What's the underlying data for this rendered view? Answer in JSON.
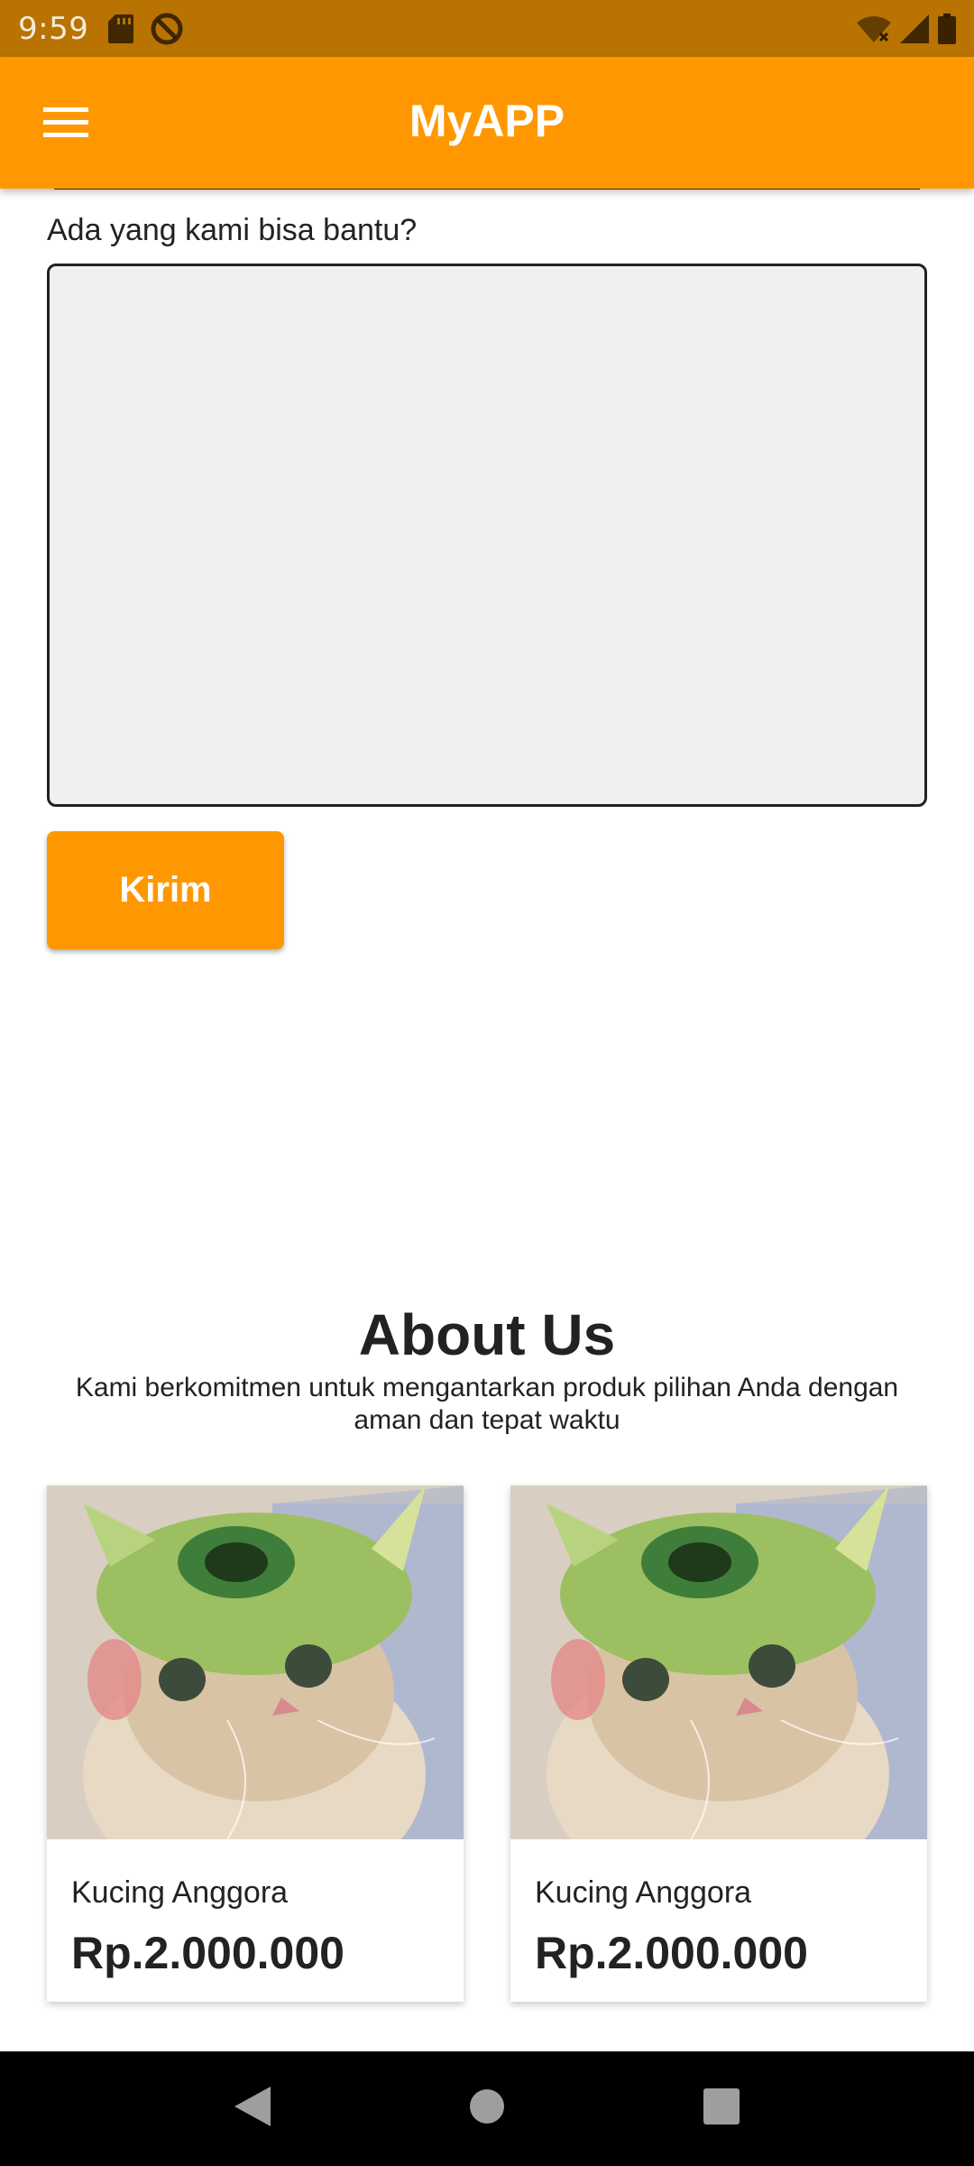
{
  "status_bar": {
    "time": "9:59",
    "icons": [
      "sd-card-icon",
      "do-not-disturb-icon",
      "wifi-icon",
      "signal-icon",
      "battery-icon"
    ]
  },
  "app_bar": {
    "title": "MyAPP",
    "menu_icon": "hamburger-menu-icon"
  },
  "form": {
    "question_label": "Ada yang kami bisa bantu?",
    "message_value": "",
    "submit_label": "Kirim"
  },
  "about": {
    "title": "About Us",
    "description": "Kami berkomitmen untuk mengantarkan produk pilihan Anda dengan aman dan tepat waktu"
  },
  "products": [
    {
      "name": "Kucing Anggora",
      "price": "Rp.2.000.000",
      "image": "cat-in-green-monster-hat"
    },
    {
      "name": "Kucing Anggora",
      "price": "Rp.2.000.000",
      "image": "cat-in-green-monster-hat"
    }
  ],
  "nav_bar": {
    "back_icon": "back-icon",
    "home_icon": "home-icon",
    "recents_icon": "recents-icon"
  },
  "colors": {
    "primary": "#ff9800",
    "status_bar": "#b97300",
    "textarea_bg": "#f0f0f0",
    "nav_bar": "#000000"
  }
}
